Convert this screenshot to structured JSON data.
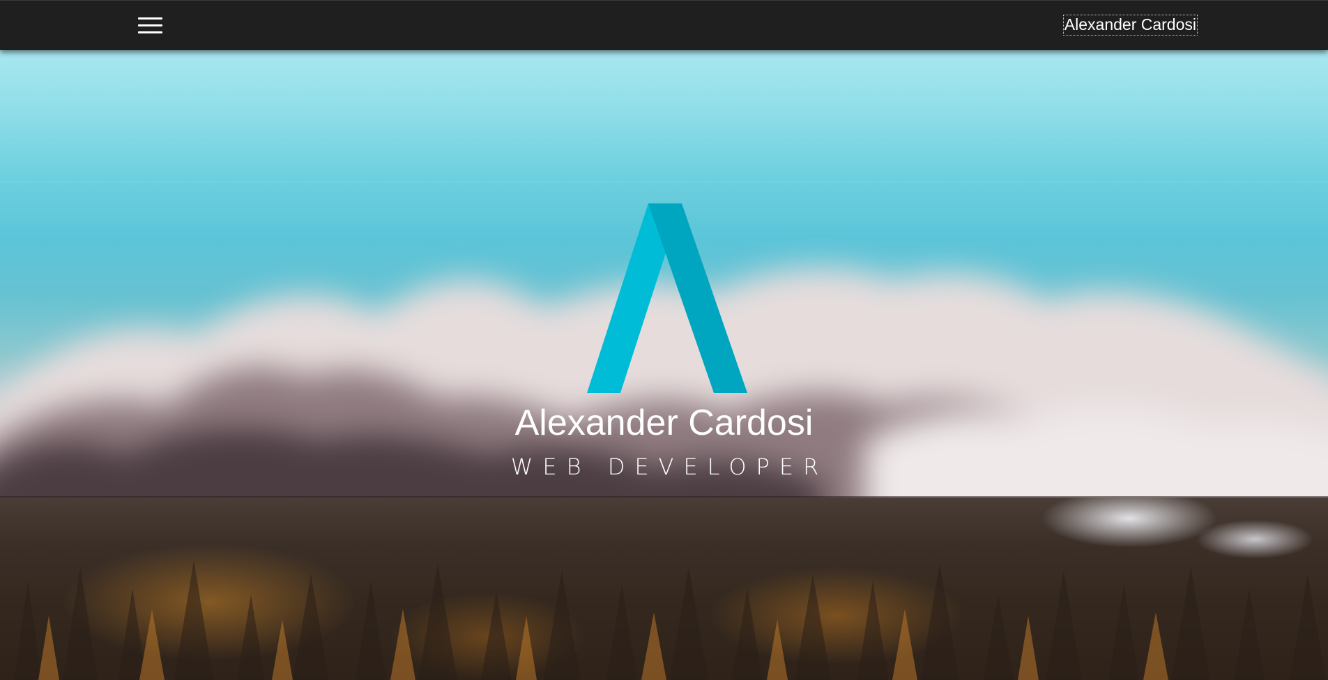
{
  "nav": {
    "menu_icon": "hamburger-menu-icon",
    "brand_link": "Alexander Cardosi"
  },
  "hero": {
    "logo": "letter-a-logo",
    "name": "Alexander Cardosi",
    "role": "WEB DEVELOPER"
  },
  "colors": {
    "topbar": "#1f1f1f",
    "logo_primary": "#00bcd6",
    "logo_secondary": "#00a6bf",
    "text": "#ffffff"
  }
}
